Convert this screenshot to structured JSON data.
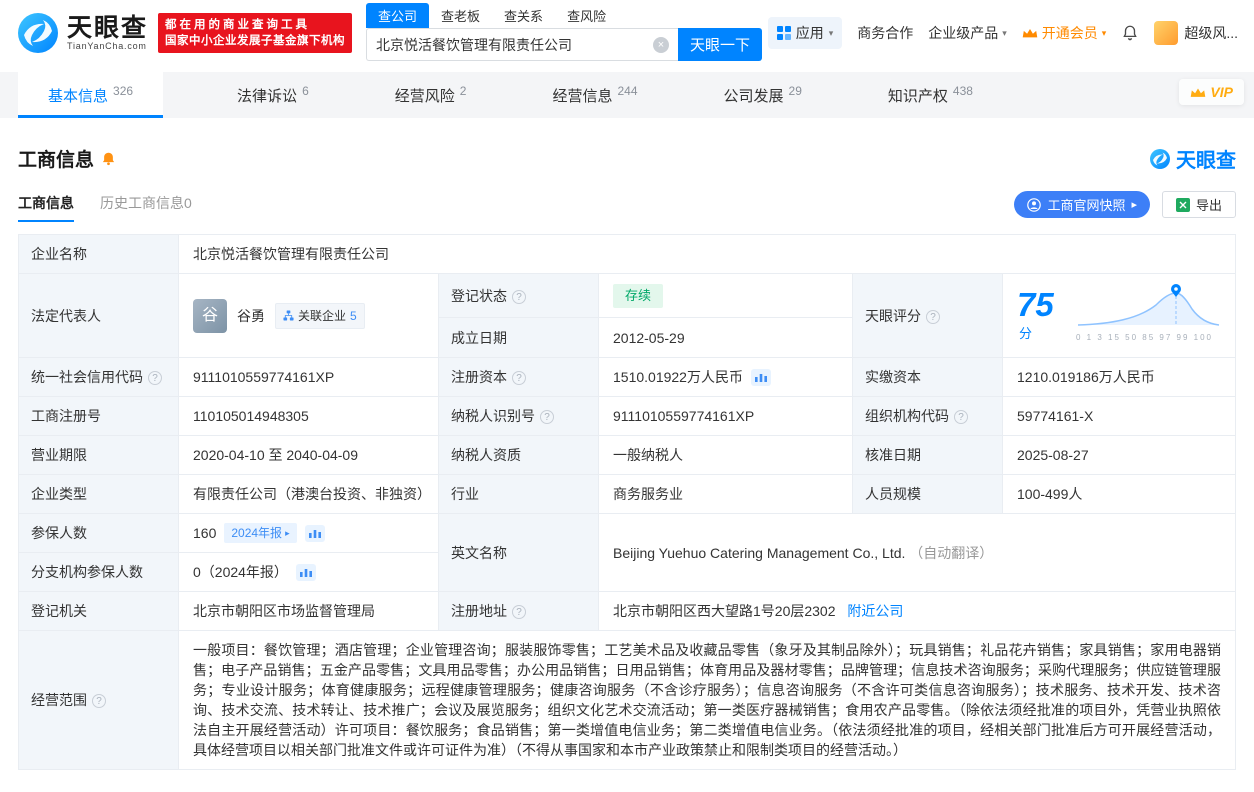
{
  "colors": {
    "primary": "#0084ff",
    "brand_red": "#e8141e",
    "vip_orange": "#ff8a00",
    "status_green": "#00a868"
  },
  "icons": {
    "caret_down": "▾",
    "chevron_right": "▸",
    "help": "?",
    "clear": "×"
  },
  "topbar": {
    "logo": {
      "cn": "天眼查",
      "en": "TianYanCha.com"
    },
    "slogan": {
      "line1": "都在用的商业查询工具",
      "line2": "国家中小企业发展子基金旗下机构"
    },
    "search_tabs": [
      {
        "label": "查公司"
      },
      {
        "label": "查老板"
      },
      {
        "label": "查关系"
      },
      {
        "label": "查风险"
      }
    ],
    "search": {
      "value": "北京悦活餐饮管理有限责任公司",
      "button": "天眼一下"
    },
    "nav": {
      "apps": "应用",
      "cooperation": "商务合作",
      "enterprise": "企业级产品",
      "vip": "开通会员",
      "user": "超级风..."
    }
  },
  "nav_tabs": [
    {
      "label": "基本信息",
      "count": "326"
    },
    {
      "label": "法律诉讼",
      "count": "6"
    },
    {
      "label": "经营风险",
      "count": "2"
    },
    {
      "label": "经营信息",
      "count": "244"
    },
    {
      "label": "公司发展",
      "count": "29"
    },
    {
      "label": "知识产权",
      "count": "438"
    }
  ],
  "vip_badge": "VIP",
  "section": {
    "title": "工商信息",
    "brand": "天眼查",
    "tab_current": "工商信息",
    "tab_history": "历史工商信息0",
    "snapshot_button": "工商官网快照",
    "export_button": "导出"
  },
  "fields": {
    "company_name": {
      "label": "企业名称",
      "value": "北京悦活餐饮管理有限责任公司"
    },
    "legal_rep": {
      "label": "法定代表人",
      "avatar_char": "谷",
      "name": "谷勇",
      "related_label": "关联企业",
      "related_count": "5"
    },
    "reg_status": {
      "label": "登记状态",
      "value": "存续"
    },
    "establish_date": {
      "label": "成立日期",
      "value": "2012-05-29"
    },
    "score": {
      "label": "天眼评分",
      "value": "75",
      "unit": "分",
      "axis": "0 1 3 15 50 85 97 99 100"
    },
    "credit_code": {
      "label": "统一社会信用代码",
      "value": "9111010559774161XP"
    },
    "reg_capital": {
      "label": "注册资本",
      "value": "1510.01922万人民币"
    },
    "paid_capital": {
      "label": "实缴资本",
      "value": "1210.019186万人民币"
    },
    "reg_number": {
      "label": "工商注册号",
      "value": "110105014948305"
    },
    "taxpayer_id": {
      "label": "纳税人识别号",
      "value": "9111010559774161XP"
    },
    "org_code": {
      "label": "组织机构代码",
      "value": "59774161-X"
    },
    "business_term": {
      "label": "营业期限",
      "value": "2020-04-10 至 2040-04-09"
    },
    "taxpayer_quality": {
      "label": "纳税人资质",
      "value": "一般纳税人"
    },
    "approval_date": {
      "label": "核准日期",
      "value": "2025-08-27"
    },
    "company_type": {
      "label": "企业类型",
      "value": "有限责任公司（港澳台投资、非独资）"
    },
    "industry": {
      "label": "行业",
      "value": "商务服务业"
    },
    "staff_size": {
      "label": "人员规模",
      "value": "100-499人"
    },
    "insured": {
      "label": "参保人数",
      "value": "160",
      "badge": "2024年报"
    },
    "english_name": {
      "label": "英文名称",
      "value": "Beijing Yuehuo Catering Management Co., Ltd.",
      "note": "（自动翻译）"
    },
    "branch_insured": {
      "label": "分支机构参保人数",
      "value": "0（2024年报）"
    },
    "reg_authority": {
      "label": "登记机关",
      "value": "北京市朝阳区市场监督管理局"
    },
    "reg_address": {
      "label": "注册地址",
      "value": "北京市朝阳区西大望路1号20层2302",
      "link": "附近公司"
    },
    "business_scope": {
      "label": "经营范围",
      "value": "一般项目：餐饮管理；酒店管理；企业管理咨询；服装服饰零售；工艺美术品及收藏品零售（象牙及其制品除外）；玩具销售；礼品花卉销售；家具销售；家用电器销售；电子产品销售；五金产品零售；文具用品零售；办公用品销售；日用品销售；体育用品及器材零售；品牌管理；信息技术咨询服务；采购代理服务；供应链管理服务；专业设计服务；体育健康服务；远程健康管理服务；健康咨询服务（不含诊疗服务）；信息咨询服务（不含许可类信息咨询服务）；技术服务、技术开发、技术咨询、技术交流、技术转让、技术推广；会议及展览服务；组织文化艺术交流活动；第一类医疗器械销售；食用农产品零售。（除依法须经批准的项目外，凭营业执照依法自主开展经营活动）许可项目：餐饮服务；食品销售；第一类增值电信业务；第二类增值电信业务。（依法须经批准的项目，经相关部门批准后方可开展经营活动，具体经营项目以相关部门批准文件或许可证件为准）（不得从事国家和本市产业政策禁止和限制类项目的经营活动。）"
    }
  }
}
